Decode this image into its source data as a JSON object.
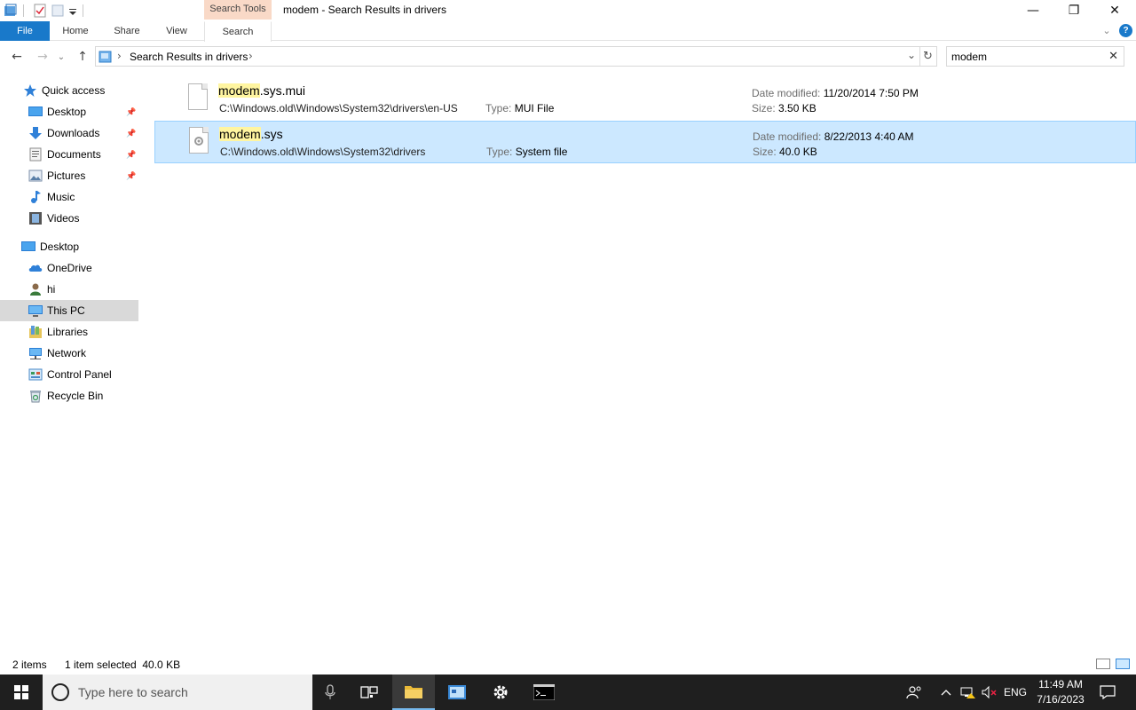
{
  "window": {
    "title": "modem - Search Results in drivers",
    "contextual_tab": "Search Tools",
    "minimize": "—",
    "maximize": "❐",
    "close": "✕"
  },
  "ribbon": {
    "tabs": [
      {
        "label": "File"
      },
      {
        "label": "Home"
      },
      {
        "label": "Share"
      },
      {
        "label": "View"
      },
      {
        "label": "Search"
      }
    ],
    "help": "?",
    "expand": "⌄"
  },
  "address": {
    "breadcrumb": "Search Results in drivers",
    "separator": "›",
    "refresh": "↻",
    "dropdown": "⌄"
  },
  "search": {
    "value": "modem",
    "clear": "✕"
  },
  "nav": {
    "back": "←",
    "forward": "→",
    "recent": "⌄",
    "up": "↑"
  },
  "sidebar": {
    "items": [
      {
        "label": "Quick access",
        "icon": "star-icon"
      },
      {
        "label": "Desktop",
        "icon": "desktop-icon",
        "pinned": true
      },
      {
        "label": "Downloads",
        "icon": "download-icon",
        "pinned": true
      },
      {
        "label": "Documents",
        "icon": "documents-icon",
        "pinned": true
      },
      {
        "label": "Pictures",
        "icon": "pictures-icon",
        "pinned": true
      },
      {
        "label": "Music",
        "icon": "music-icon"
      },
      {
        "label": "Videos",
        "icon": "videos-icon"
      },
      {
        "label": "Desktop",
        "icon": "desktop-icon"
      },
      {
        "label": "OneDrive",
        "icon": "cloud-icon"
      },
      {
        "label": "hi",
        "icon": "user-icon"
      },
      {
        "label": "This PC",
        "icon": "computer-icon"
      },
      {
        "label": "Libraries",
        "icon": "libraries-icon"
      },
      {
        "label": "Network",
        "icon": "network-icon"
      },
      {
        "label": "Control Panel",
        "icon": "control-panel-icon"
      },
      {
        "label": "Recycle Bin",
        "icon": "recycle-bin-icon"
      }
    ]
  },
  "results": [
    {
      "name_match": "modem",
      "name_rest": ".sys.mui",
      "path": "C:\\Windows.old\\Windows\\System32\\drivers\\en-US",
      "type_label": "Type:",
      "type": "MUI File",
      "date_label": "Date modified:",
      "date": "11/20/2014 7:50 PM",
      "size_label": "Size:",
      "size": "3.50 KB"
    },
    {
      "name_match": "modem",
      "name_rest": ".sys",
      "path": "C:\\Windows.old\\Windows\\System32\\drivers",
      "type_label": "Type:",
      "type": "System file",
      "date_label": "Date modified:",
      "date": "8/22/2013 4:40 AM",
      "size_label": "Size:",
      "size": "40.0 KB"
    }
  ],
  "status": {
    "count": "2 items",
    "selection": "1 item selected  40.0 KB"
  },
  "taskbar": {
    "search_placeholder": "Type here to search",
    "language": "ENG",
    "time": "11:49 AM",
    "date": "7/16/2023"
  },
  "colors": {
    "accent": "#1979ca",
    "selection": "#cce8ff",
    "highlight": "#fff5a0",
    "taskbar": "#1f1f1f"
  }
}
